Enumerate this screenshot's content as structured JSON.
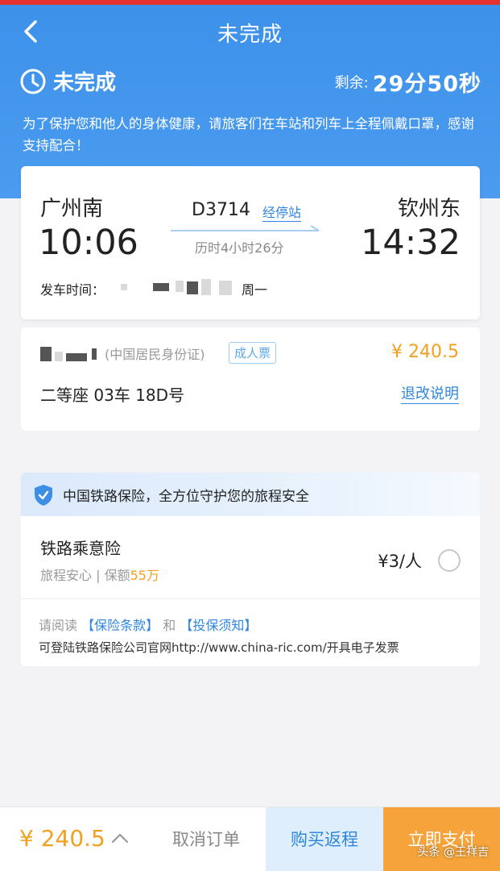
{
  "nav": {
    "title": "未完成"
  },
  "status": {
    "label": "未完成",
    "remaining_label": "剩余:",
    "remaining_value": "29分50秒"
  },
  "notice": "为了保护您和他人的身体健康，请旅客们在车站和列车上全程佩戴口罩，感谢支持配合！",
  "trip": {
    "from_station": "广州南",
    "from_time": "10:06",
    "train_no": "D3714",
    "stops_link": "经停站",
    "duration": "历时4小时26分",
    "to_station": "钦州东",
    "to_time": "14:32",
    "departure_label": "发车时间：",
    "weekday": "周一"
  },
  "passenger": {
    "id_type": "(中国居民身份证)",
    "ticket_type": "成人票",
    "price": "¥ 240.5",
    "seat": "二等座  03车  18D号",
    "refund_link": "退改说明"
  },
  "insurance": {
    "banner": "中国铁路保险，全方位守护您的旅程安全",
    "name": "铁路乘意险",
    "sub_prefix": "旅程安心 | 保额",
    "sub_amount": "55万",
    "price": "¥3/人",
    "read_prefix": "请阅读",
    "terms_link": "【保险条款】",
    "and": "和",
    "notice_link": "【投保须知】",
    "invoice": "可登陆铁路保险公司官网http://www.china-ric.com/开具电子发票"
  },
  "bottom": {
    "total": "¥ 240.5",
    "cancel": "取消订单",
    "return_ticket": "购买返程",
    "pay": "立即支付"
  },
  "watermark": "头条 @王祥吉",
  "colors": {
    "header_blue": "#3d91e9",
    "link_blue": "#2f86e0",
    "price_orange": "#f2a020",
    "pay_button": "#f5a33a"
  }
}
